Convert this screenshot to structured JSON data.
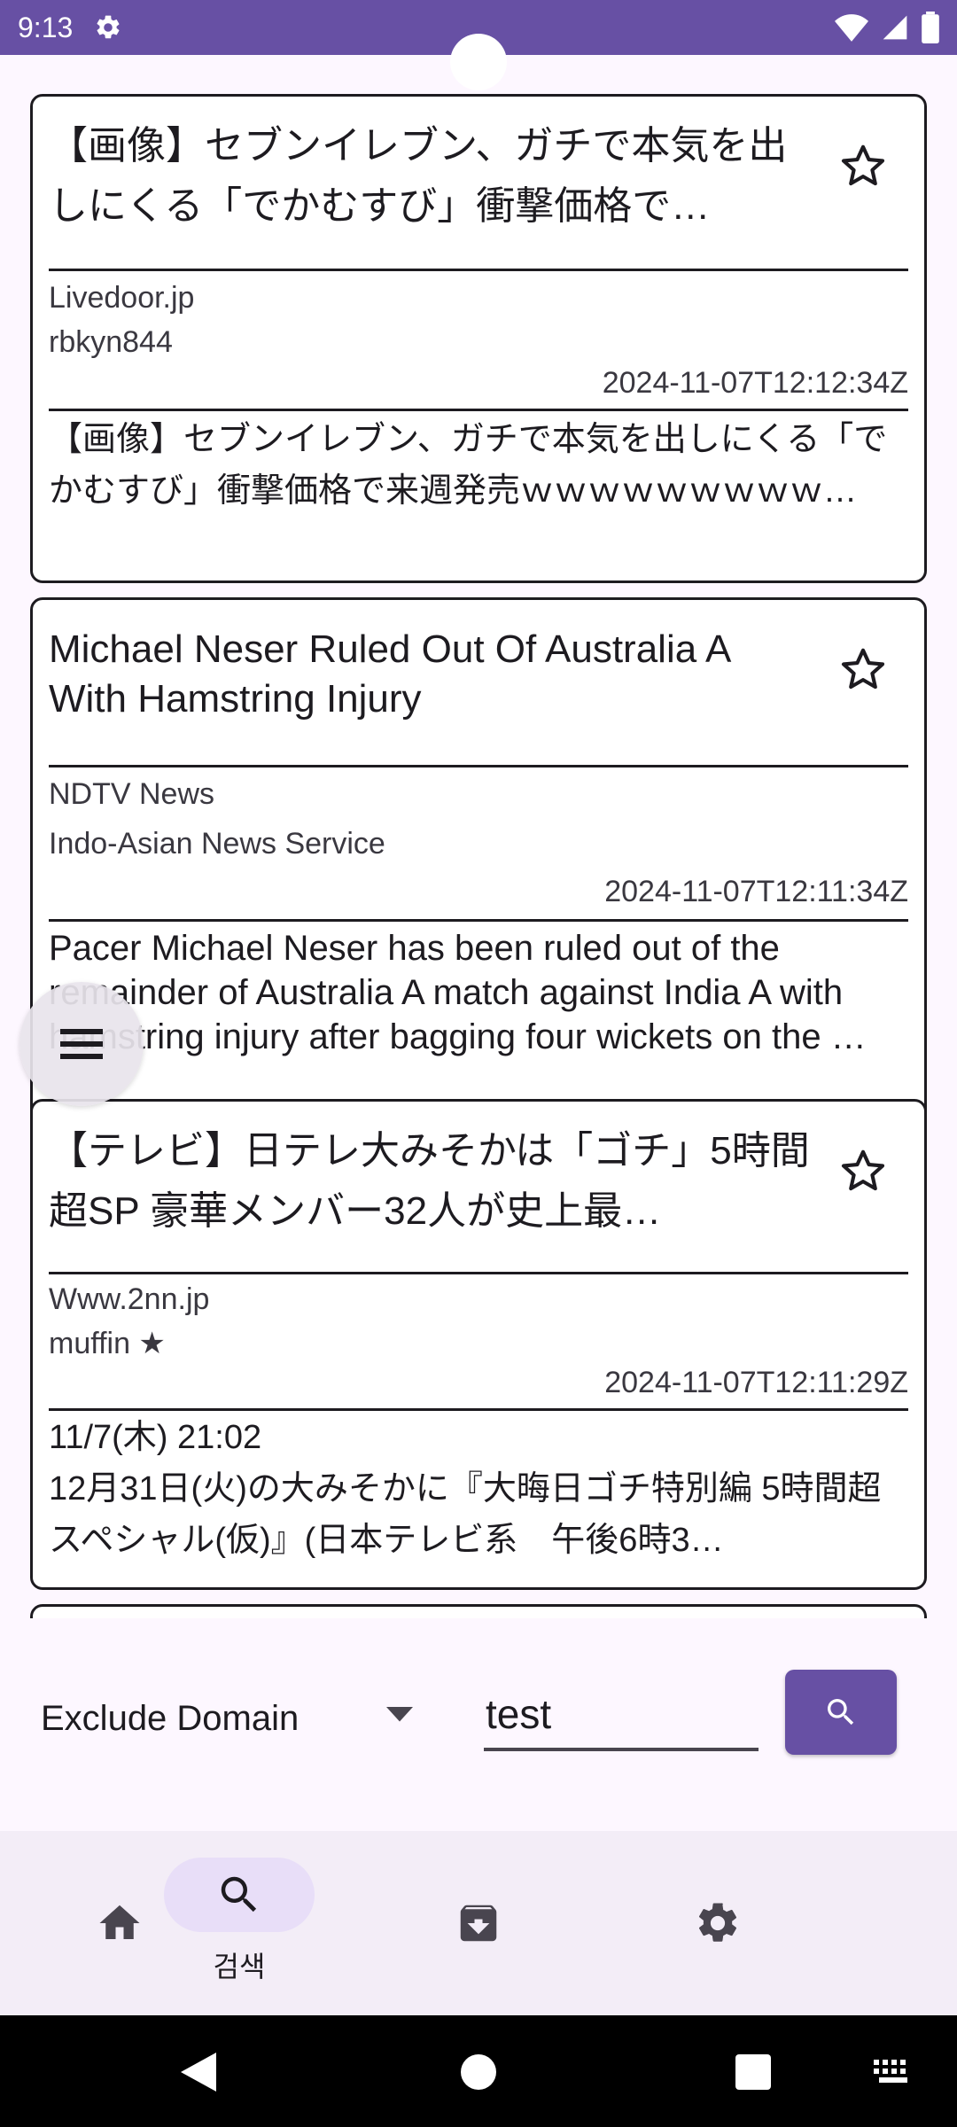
{
  "status_bar": {
    "time": "9:13",
    "icons": [
      "gear-icon",
      "wifi-icon",
      "signal-icon",
      "battery-icon"
    ]
  },
  "articles": [
    {
      "title": "【画像】セブンイレブン、ガチで本気を出しにくる「でかむすび」衝撃価格で…",
      "source": "Livedoor.jp",
      "author": "rbkyn844",
      "published": "2024-11-07T12:12:34Z",
      "description": "【画像】セブンイレブン、ガチで本気を出しにくる「でかむすび」衝撃価格で来週発売ｗｗｗｗｗｗｗｗｗ…"
    },
    {
      "title": "Michael Neser Ruled Out Of Australia A With Hamstring Injury",
      "source": "NDTV News",
      "author": "Indo-Asian News Service",
      "published": "2024-11-07T12:11:34Z",
      "description": "Pacer Michael Neser has been ruled out of the remainder of Australia A match against India A with hamstring injury after bagging four wickets on the …"
    },
    {
      "title": "【テレビ】日テレ大みそかは「ゴチ」5時間超SP 豪華メンバー32人が史上最…",
      "source": "Www.2nn.jp",
      "author": "muffin ★",
      "published": "2024-11-07T12:11:29Z",
      "description": "11/7(木) 21:02\n12月31日(火)の大みそかに『大晦日ゴチ特別編 5時間超スペシャル(仮)』(日本テレビ系　午後6時3…"
    }
  ],
  "search": {
    "filter_label": "Exclude Domain",
    "query": "test"
  },
  "bottom_nav": {
    "items": [
      {
        "icon": "home-icon",
        "label": ""
      },
      {
        "icon": "search-icon",
        "label": "검색"
      },
      {
        "icon": "archive-icon",
        "label": ""
      },
      {
        "icon": "settings-icon",
        "label": ""
      }
    ],
    "active_index": 1
  },
  "colors": {
    "primary": "#6750a4",
    "nav_background": "#f3edf7",
    "active_pill": "#e8def8"
  }
}
